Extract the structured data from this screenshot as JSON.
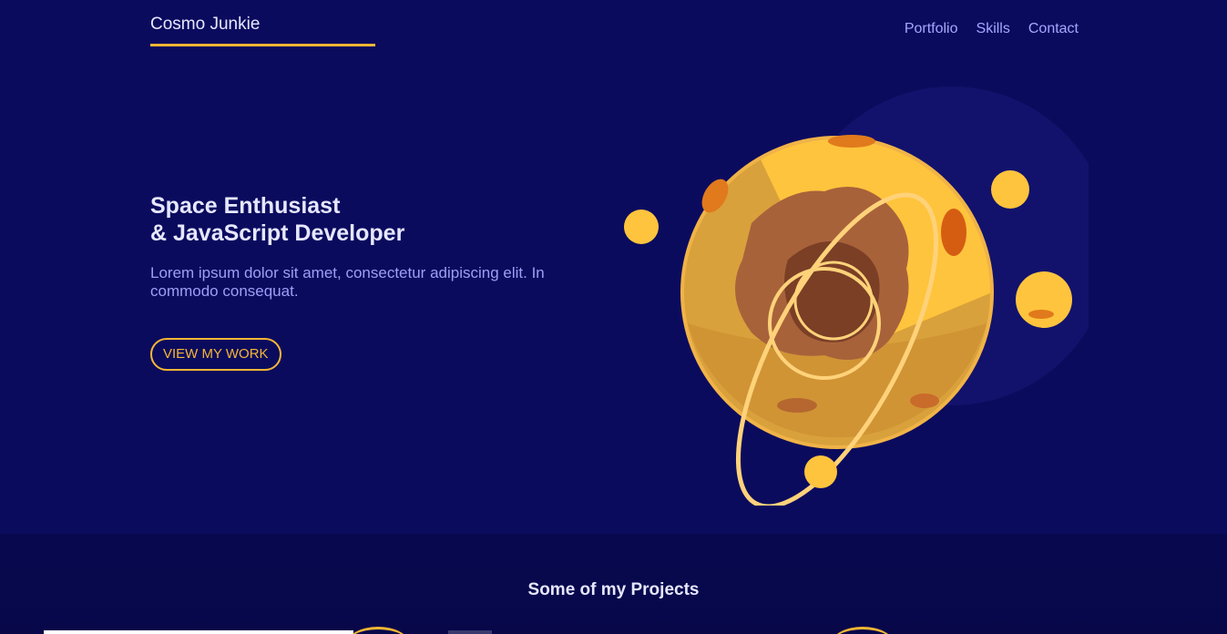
{
  "header": {
    "brand": "Cosmo Junkie",
    "nav": [
      "Portfolio",
      "Skills",
      "Contact"
    ]
  },
  "hero": {
    "title_line1": "Space Enthusiast",
    "title_line2": "& JavaScript Developer",
    "text": "Lorem ipsum dolor sit amet, consectetur adipiscing elit. In commodo consequat.",
    "cta": "VIEW MY WORK"
  },
  "projects": {
    "title": "Some of my Projects"
  },
  "colors": {
    "background": "#0b0b5e",
    "accent": "#f5b733",
    "heading": "#e6e7ff",
    "nav": "#a3a8ff"
  }
}
